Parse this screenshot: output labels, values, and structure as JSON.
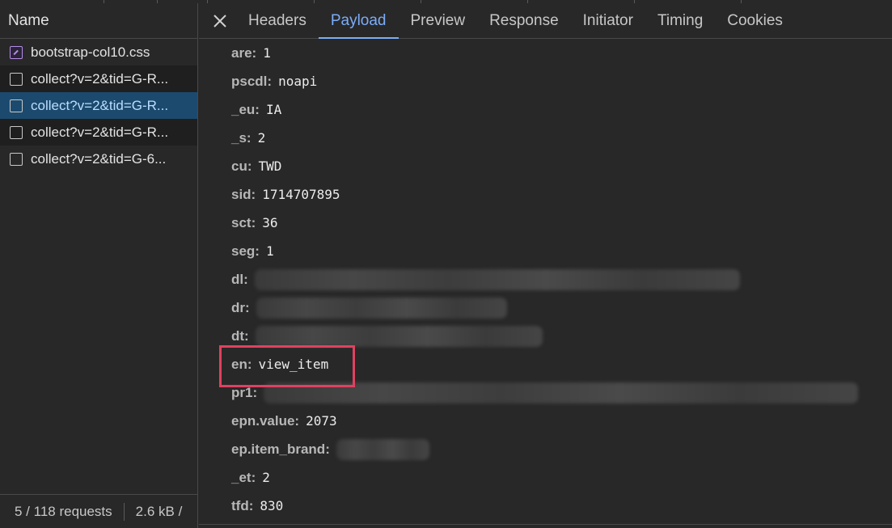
{
  "request_list": {
    "header": "Name",
    "items": [
      {
        "label": "bootstrap-col10.css",
        "icon": "css-file-icon",
        "state": "normal"
      },
      {
        "label": "collect?v=2&tid=G-R...",
        "icon": "checkbox-icon",
        "state": "alt"
      },
      {
        "label": "collect?v=2&tid=G-R...",
        "icon": "checkbox-icon",
        "state": "selected"
      },
      {
        "label": "collect?v=2&tid=G-R...",
        "icon": "checkbox-icon",
        "state": "alt"
      },
      {
        "label": "collect?v=2&tid=G-6...",
        "icon": "checkbox-icon",
        "state": "normal"
      }
    ],
    "footer": {
      "requests": "5 / 118 requests",
      "transferred": "2.6 kB /"
    }
  },
  "detail": {
    "close_icon": "close-icon",
    "tabs": [
      {
        "label": "Headers"
      },
      {
        "label": "Payload",
        "active": true
      },
      {
        "label": "Preview"
      },
      {
        "label": "Response"
      },
      {
        "label": "Initiator"
      },
      {
        "label": "Timing"
      },
      {
        "label": "Cookies"
      }
    ],
    "payload": [
      {
        "key": "are:",
        "value": "1"
      },
      {
        "key": "pscdl:",
        "value": "noapi"
      },
      {
        "key": "_eu:",
        "value": "IA"
      },
      {
        "key": "_s:",
        "value": "2"
      },
      {
        "key": "cu:",
        "value": "TWD"
      },
      {
        "key": "sid:",
        "value": "1714707895"
      },
      {
        "key": "sct:",
        "value": "36"
      },
      {
        "key": "seg:",
        "value": "1"
      },
      {
        "key": "dl:",
        "value": "",
        "redacted": true
      },
      {
        "key": "dr:",
        "value": "",
        "redacted": true
      },
      {
        "key": "dt:",
        "value": "",
        "redacted": true
      },
      {
        "key": "en:",
        "value": "view_item",
        "highlighted": true
      },
      {
        "key": "pr1:",
        "value": "",
        "redacted": true
      },
      {
        "key": "epn.value:",
        "value": "2073"
      },
      {
        "key": "ep.item_brand:",
        "value": "",
        "redacted": true
      },
      {
        "key": "_et:",
        "value": "2"
      },
      {
        "key": "tfd:",
        "value": "830"
      }
    ]
  },
  "colors": {
    "accent": "#7cacf8",
    "highlight": "#e0415f",
    "selected_row": "#1c4a6e"
  }
}
